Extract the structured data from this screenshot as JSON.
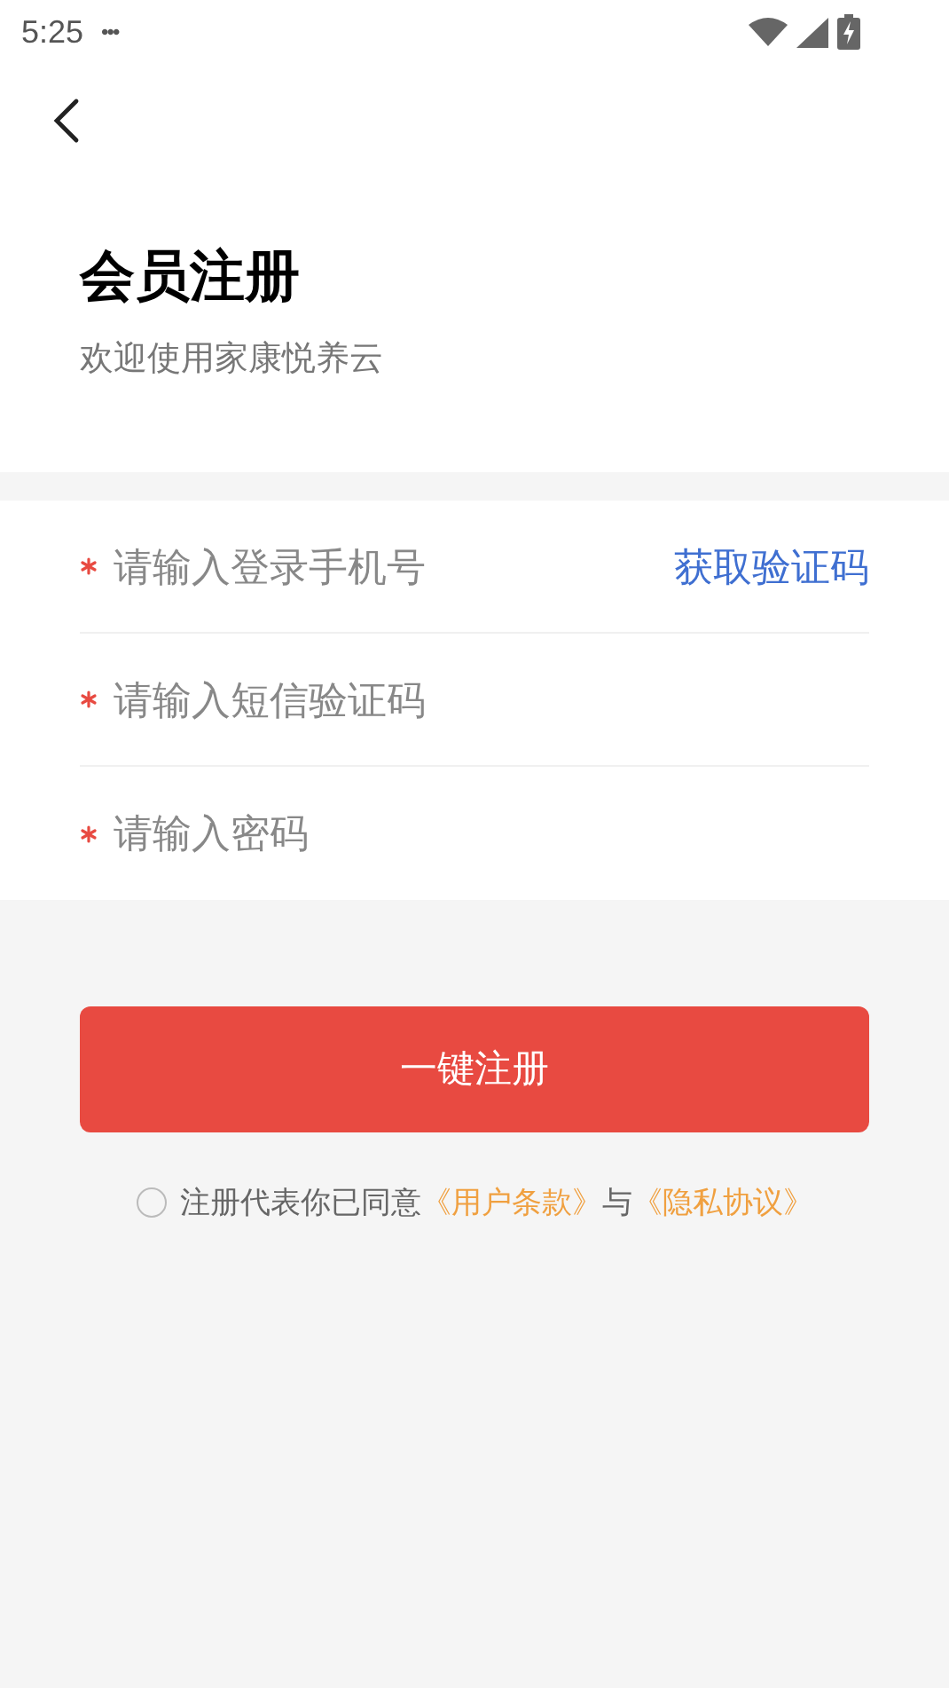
{
  "status_bar": {
    "time": "5:25",
    "more": "•••"
  },
  "header": {
    "title": "会员注册",
    "subtitle": "欢迎使用家康悦养云"
  },
  "form": {
    "fields": [
      {
        "required": true,
        "placeholder": "请输入登录手机号",
        "action": "获取验证码"
      },
      {
        "required": true,
        "placeholder": "请输入短信验证码"
      },
      {
        "required": true,
        "placeholder": "请输入密码"
      }
    ]
  },
  "submit": "一键注册",
  "agreement": {
    "checked": false,
    "text": "注册代表你已同意",
    "terms_link": "《用户条款》",
    "joiner": "与",
    "privacy_link": "《隐私协议》"
  }
}
